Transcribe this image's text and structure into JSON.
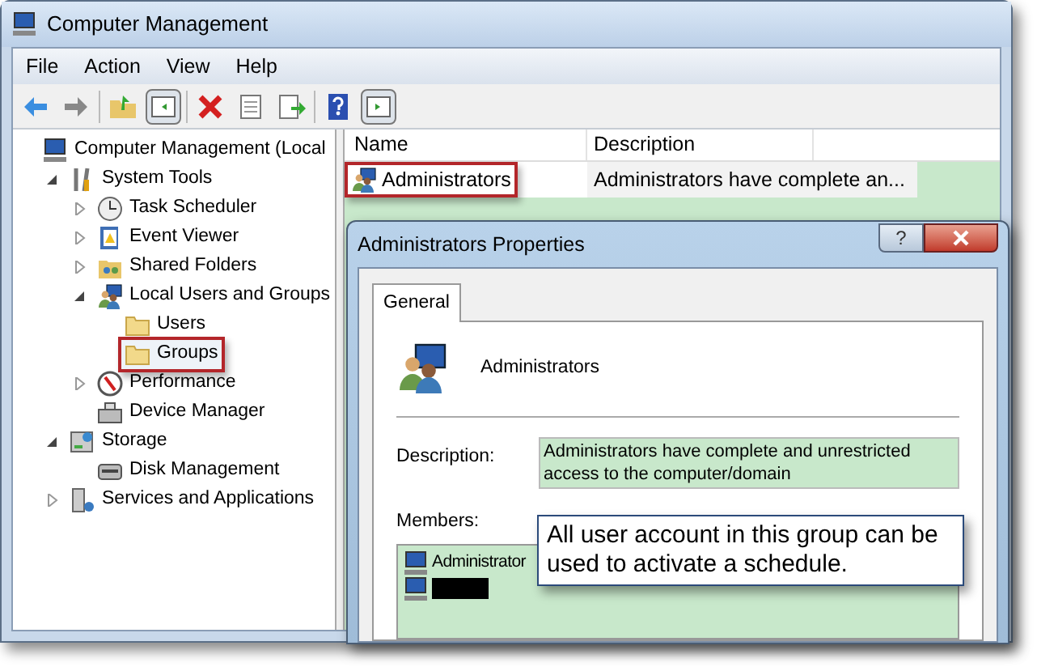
{
  "window": {
    "title": "Computer Management"
  },
  "menu": [
    "File",
    "Action",
    "View",
    "Help"
  ],
  "tree": [
    {
      "label": "Computer Management (Local",
      "kind": "computer",
      "selected": false,
      "children": [
        {
          "label": "System Tools",
          "kind": "tools",
          "expanded": true,
          "selected": false,
          "children": [
            {
              "label": "Task Scheduler",
              "kind": "clock",
              "expanded": false,
              "selected": false
            },
            {
              "label": "Event Viewer",
              "kind": "log",
              "expanded": false,
              "selected": false
            },
            {
              "label": "Shared Folders",
              "kind": "share",
              "expanded": false,
              "selected": false
            },
            {
              "label": "Local Users and Groups",
              "kind": "users",
              "expanded": true,
              "selected": false,
              "children": [
                {
                  "label": "Users",
                  "kind": "folder",
                  "selected": false
                },
                {
                  "label": "Groups",
                  "kind": "folder",
                  "selected": true
                }
              ]
            },
            {
              "label": "Performance",
              "kind": "gauge",
              "expanded": false,
              "selected": false
            },
            {
              "label": "Device Manager",
              "kind": "device",
              "selected": false
            }
          ]
        },
        {
          "label": "Storage",
          "kind": "storage",
          "expanded": true,
          "selected": false,
          "children": [
            {
              "label": "Disk Management",
              "kind": "disk",
              "selected": false
            }
          ]
        },
        {
          "label": "Services and Applications",
          "kind": "services",
          "expanded": false,
          "selected": false
        }
      ]
    }
  ],
  "table": {
    "columns": [
      "Name",
      "Description"
    ],
    "rows": [
      {
        "name": "Administrators",
        "description": "Administrators have complete an...",
        "selected": true
      }
    ]
  },
  "dialog": {
    "title": "Administrators Properties",
    "help": "?",
    "tabs": [
      {
        "label": "General",
        "selected": true
      }
    ],
    "group_name": "Administrators",
    "description_label": "Description:",
    "description": "Administrators have complete and unrestricted access to the computer/domain",
    "members_label": "Members:",
    "members": [
      {
        "kind": "user",
        "name": "Administrator"
      },
      {
        "kind": "redacted"
      }
    ]
  },
  "callout": "All user account in this group can be used to activate a schedule."
}
